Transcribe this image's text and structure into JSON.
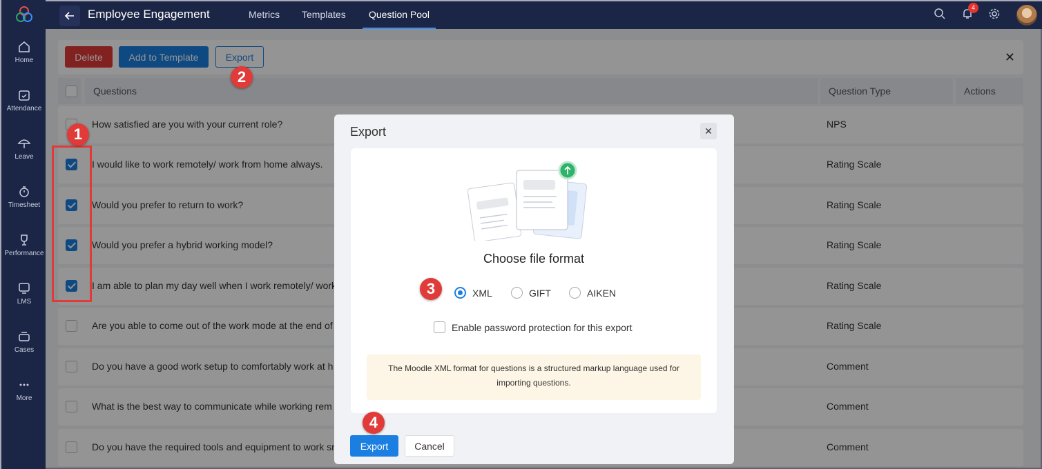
{
  "sidebar": {
    "logo": "zoho-people-logo",
    "items": [
      {
        "label": "Home",
        "icon": "home-icon"
      },
      {
        "label": "Attendance",
        "icon": "calendar-check-icon"
      },
      {
        "label": "Leave",
        "icon": "umbrella-icon"
      },
      {
        "label": "Timesheet",
        "icon": "timer-icon"
      },
      {
        "label": "Performance",
        "icon": "trophy-icon"
      },
      {
        "label": "LMS",
        "icon": "screen-icon"
      },
      {
        "label": "Cases",
        "icon": "inbox-icon"
      },
      {
        "label": "More",
        "icon": "more-dots-icon"
      }
    ]
  },
  "topbar": {
    "title": "Employee Engagement",
    "tabs": [
      {
        "label": "Metrics"
      },
      {
        "label": "Templates"
      },
      {
        "label": "Question Pool",
        "active": true
      }
    ],
    "notification_count": "4"
  },
  "toolbar": {
    "delete_label": "Delete",
    "add_template_label": "Add to Template",
    "export_label": "Export",
    "close_glyph": "✕"
  },
  "table": {
    "headers": {
      "questions": "Questions",
      "type": "Question Type",
      "actions": "Actions"
    },
    "rows": [
      {
        "question": "How satisfied are you with your current role?",
        "type": "NPS",
        "checked": false
      },
      {
        "question": "I would like to work remotely/ work from home always.",
        "type": "Rating Scale",
        "checked": true
      },
      {
        "question": "Would you prefer to return to work?",
        "type": "Rating Scale",
        "checked": true
      },
      {
        "question": "Would you prefer a hybrid working model?",
        "type": "Rating Scale",
        "checked": true
      },
      {
        "question": "I am able to plan my day well when I work remotely/ work",
        "type": "Rating Scale",
        "checked": true
      },
      {
        "question": "Are you able to come out of the work mode at the end of",
        "type": "Rating Scale",
        "checked": false
      },
      {
        "question": "Do you have a good work setup to comfortably work at h",
        "type": "Comment",
        "checked": false
      },
      {
        "question": "What is the best way to communicate while working rem",
        "type": "Comment",
        "checked": false
      },
      {
        "question": "Do you have the required tools and equipment to work sr",
        "type": "Comment",
        "checked": false
      }
    ]
  },
  "modal": {
    "title": "Export",
    "close_glyph": "✕",
    "choose_label": "Choose file format",
    "formats": [
      {
        "label": "XML",
        "selected": true
      },
      {
        "label": "GIFT",
        "selected": false
      },
      {
        "label": "AIKEN",
        "selected": false
      }
    ],
    "password_label": "Enable password protection for this export",
    "note_line1": "The Moodle XML format for questions is a structured markup language used for",
    "note_line2": "importing questions.",
    "export_label": "Export",
    "cancel_label": "Cancel"
  },
  "markers": [
    "1",
    "2",
    "3",
    "4"
  ],
  "colors": {
    "accent": "#1a7fe0",
    "danger": "#e03b38",
    "nav_bg": "#1b2545"
  }
}
